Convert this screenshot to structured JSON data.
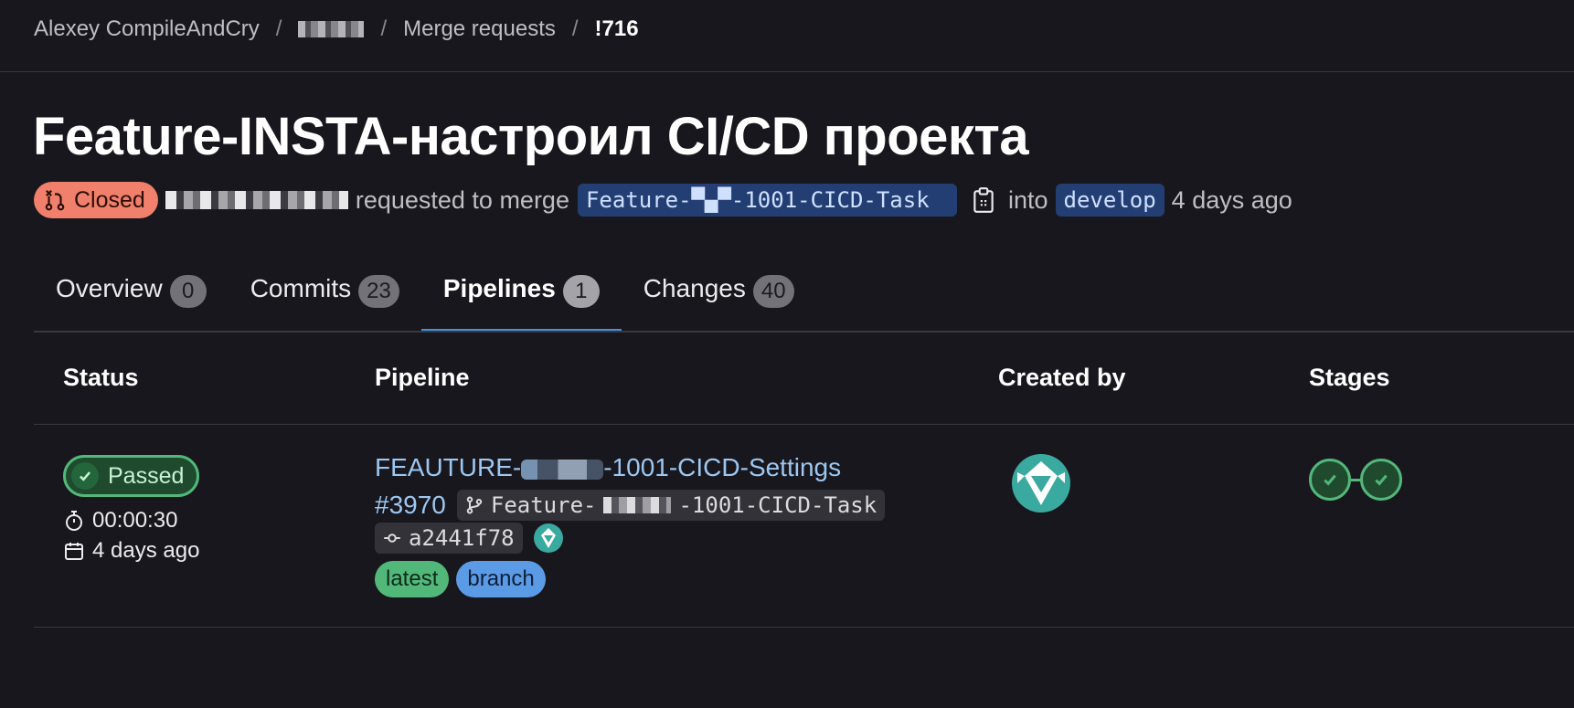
{
  "breadcrumb": {
    "owner": "Alexey CompileAndCry",
    "section": "Merge requests",
    "current": "!716",
    "separator": "/"
  },
  "mr": {
    "title": "Feature-INSTA-настроил CI/CD проекта",
    "state": "Closed",
    "action_text": "requested to merge",
    "source_branch": "Feature-▀▄▀-1001-CICD-Task",
    "into_text": "into",
    "target_branch": "develop",
    "time_ago": "4 days ago"
  },
  "tabs": [
    {
      "label": "Overview",
      "count": "0"
    },
    {
      "label": "Commits",
      "count": "23"
    },
    {
      "label": "Pipelines",
      "count": "1"
    },
    {
      "label": "Changes",
      "count": "40"
    }
  ],
  "table": {
    "headers": {
      "status": "Status",
      "pipeline": "Pipeline",
      "created_by": "Created by",
      "stages": "Stages"
    }
  },
  "pipeline": {
    "status": "Passed",
    "duration": "00:00:30",
    "finished": "4 days ago",
    "name_prefix": "FEAUTURE-",
    "name_suffix": "-1001-CICD-Settings",
    "id": "#3970",
    "ref_prefix": "Feature-",
    "ref_suffix": "-1001-CICD-Task",
    "commit": "a2441f78",
    "tags": {
      "latest": "latest",
      "branch": "branch"
    }
  },
  "colors": {
    "background": "#18171d",
    "closed_badge": "#f0806b",
    "passed": "#52b87a",
    "link": "#9dc7f1",
    "active_tab": "#428fdc",
    "branch_chip": "#233e73"
  }
}
